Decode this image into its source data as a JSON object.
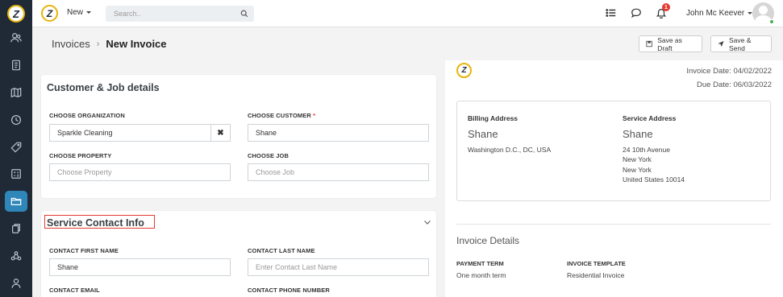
{
  "app": {
    "logo_letter": "Z"
  },
  "sidebar": {
    "items": [
      {
        "name": "users",
        "active": false
      },
      {
        "name": "document",
        "active": false
      },
      {
        "name": "map",
        "active": false
      },
      {
        "name": "clock",
        "active": false
      },
      {
        "name": "tag",
        "active": false
      },
      {
        "name": "calculator",
        "active": false
      },
      {
        "name": "folder",
        "active": true
      },
      {
        "name": "copy",
        "active": false
      },
      {
        "name": "network",
        "active": false
      },
      {
        "name": "person",
        "active": false
      }
    ]
  },
  "topbar": {
    "new_label": "New",
    "search_placeholder": "Search..",
    "notification_count": "1",
    "user_name": "John Mc Keever"
  },
  "header": {
    "breadcrumb_parent": "Invoices",
    "breadcrumb_separator": "›",
    "breadcrumb_current": "New Invoice",
    "save_draft_label": "Save as Draft",
    "save_send_label": "Save & Send"
  },
  "customer_section": {
    "title": "Customer & Job details",
    "org_label": "CHOOSE ORGANIZATION",
    "org_value": "Sparkle Cleaning",
    "clear_symbol": "✖",
    "customer_label": "CHOOSE CUSTOMER",
    "required_mark": "*",
    "customer_value": "Shane",
    "property_label": "CHOOSE PROPERTY",
    "property_placeholder": "Choose Property",
    "job_label": "CHOOSE JOB",
    "job_placeholder": "Choose Job"
  },
  "contact_section": {
    "title": "Service Contact Info",
    "first_name_label": "CONTACT FIRST NAME",
    "first_name_value": "Shane",
    "last_name_label": "CONTACT LAST NAME",
    "last_name_placeholder": "Enter Contact Last Name",
    "email_label": "CONTACT EMAIL",
    "phone_label": "CONTACT PHONE NUMBER"
  },
  "preview": {
    "invoice_date": "Invoice Date: 04/02/2022",
    "due_date": "Due Date: 06/03/2022",
    "billing": {
      "label": "Billing Address",
      "name": "Shane",
      "lines": [
        "Washington D.C., DC, USA"
      ]
    },
    "service": {
      "label": "Service Address",
      "name": "Shane",
      "lines": [
        "24 10th Avenue",
        "New York",
        "New York",
        "United States 10014"
      ]
    },
    "details_title": "Invoice Details",
    "payment_term_label": "PAYMENT TERM",
    "payment_term_value": "One month term",
    "template_label": "INVOICE TEMPLATE",
    "template_value": "Residential Invoice"
  },
  "colors": {
    "sidebar_bg": "#1f2a36",
    "active_item": "#2f86b9",
    "logo_ring": "#e8b40c",
    "highlight": "#e53935"
  }
}
